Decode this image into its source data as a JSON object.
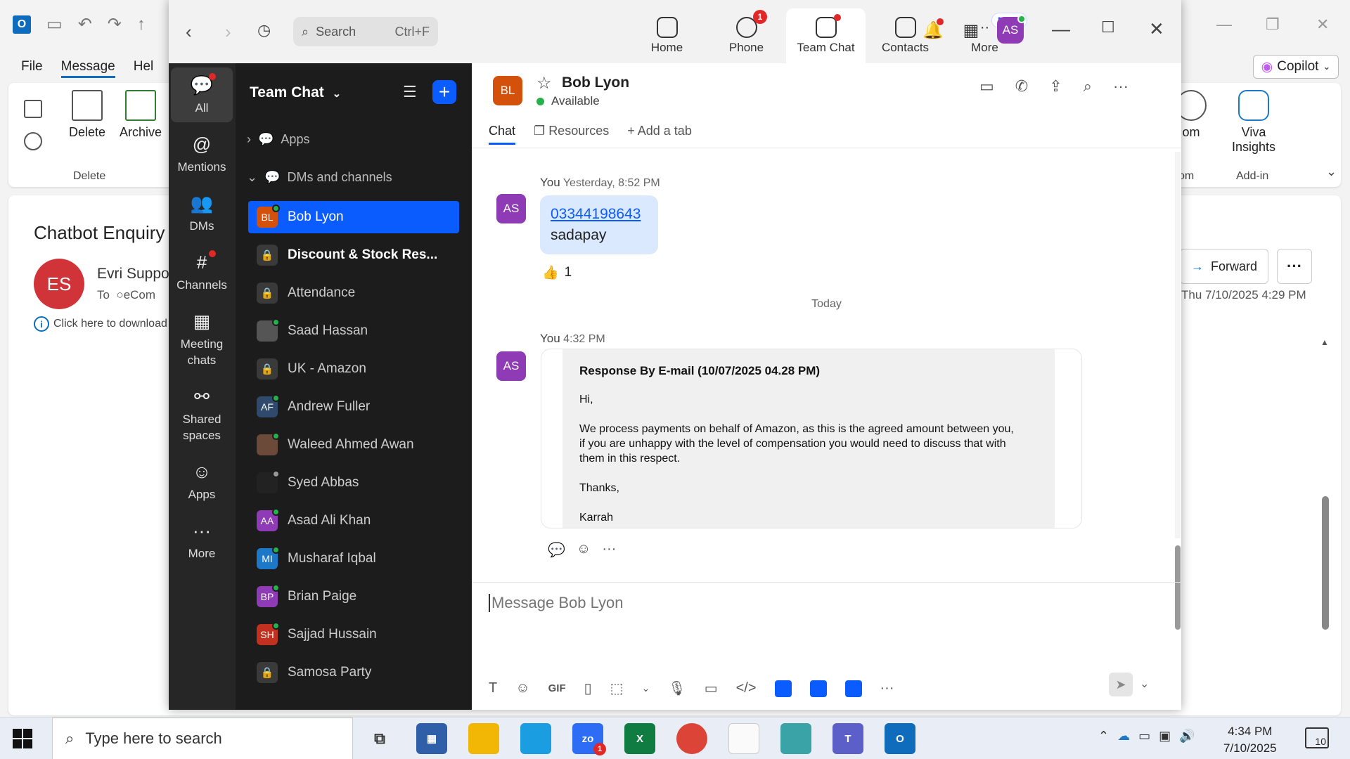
{
  "outlook": {
    "menus": [
      "File",
      "Message",
      "Hel"
    ],
    "ribbon": {
      "delete_label": "Delete",
      "archive_label": "Archive",
      "group_delete": "Delete",
      "zoom_partial": "om",
      "group_zoom_partial": "om",
      "viva_label": "Viva Insights",
      "group_addin": "Add-in",
      "copilot_label": "Copilot"
    },
    "subject": "Chatbot Enquiry",
    "sender_initials": "ES",
    "sender": "Evri Suppo",
    "to_label": "To",
    "to_value": "eCom",
    "info_text": "Click here to download",
    "forward_label": "Forward",
    "date": "Thu 7/10/2025 4:29 PM"
  },
  "zoom": {
    "search_placeholder": "Search",
    "search_shortcut": "Ctrl+F",
    "tabs": [
      {
        "label": "Home"
      },
      {
        "label": "Phone",
        "badge": "1"
      },
      {
        "label": "Team Chat"
      },
      {
        "label": "Contacts"
      },
      {
        "label": "More",
        "badge": "NEW"
      }
    ],
    "user_initials": "AS",
    "rail": [
      {
        "label": "All"
      },
      {
        "label": "Mentions"
      },
      {
        "label": "DMs"
      },
      {
        "label": "Channels"
      },
      {
        "label": "Meeting chats"
      },
      {
        "label": "Shared spaces"
      },
      {
        "label": "Apps"
      },
      {
        "label": "More"
      }
    ],
    "list": {
      "title": "Team Chat",
      "sections": {
        "apps": "Apps",
        "dms": "DMs and channels"
      },
      "items": [
        {
          "initials": "BL",
          "name": "Bob Lyon",
          "color": "#d3510a"
        },
        {
          "initials": "",
          "name": "Discount & Stock Res...",
          "color": "#3a3a3a"
        },
        {
          "initials": "",
          "name": "Attendance",
          "color": "#3a3a3a"
        },
        {
          "initials": "",
          "name": "Saad Hassan",
          "color": "#555555"
        },
        {
          "initials": "",
          "name": "UK - Amazon",
          "color": "#3a3a3a"
        },
        {
          "initials": "AF",
          "name": "Andrew Fuller",
          "color": "#2f4a6d"
        },
        {
          "initials": "",
          "name": "Waleed Ahmed Awan",
          "color": "#6b4a3a"
        },
        {
          "initials": "",
          "name": "Syed Abbas",
          "color": "#222222"
        },
        {
          "initials": "AA",
          "name": "Asad Ali Khan",
          "color": "#8e3bb5"
        },
        {
          "initials": "MI",
          "name": "Musharaf Iqbal",
          "color": "#1e78c8"
        },
        {
          "initials": "BP",
          "name": "Brian Paige",
          "color": "#8e3bb5"
        },
        {
          "initials": "SH",
          "name": "Sajjad Hussain",
          "color": "#c2311f"
        },
        {
          "initials": "",
          "name": "Samosa Party",
          "color": "#3a3a3a"
        }
      ]
    },
    "chat": {
      "contact_initials": "BL",
      "contact_name": "Bob Lyon",
      "status": "Available",
      "tabs": {
        "chat": "Chat",
        "resources": "Resources",
        "add": "Add a tab"
      },
      "msg1": {
        "sender": "You",
        "time": "Yesterday, 8:52 PM",
        "initials": "AS",
        "link": "03344198643",
        "text": "sadapay",
        "reaction_emoji": "👍",
        "reaction_count": "1"
      },
      "day_divider": "Today",
      "msg2": {
        "sender": "You",
        "time": "4:32 PM",
        "initials": "AS",
        "heading": "Response By E-mail (10/07/2025 04.28 PM)",
        "greeting": "Hi,",
        "body": "We process payments on behalf of Amazon, as this is the agreed amount between you, if you are unhappy with the level of compensation you would need to discuss that with them in this respect.",
        "thanks": "Thanks,",
        "signature": "Karrah"
      },
      "composer_placeholder": "Message Bob Lyon",
      "gif_label": "GIF"
    }
  },
  "taskbar": {
    "search_placeholder": "Type here to search",
    "time": "4:34 PM",
    "date": "7/10/2025",
    "notification_count": "10",
    "zoom_badge": "1"
  }
}
